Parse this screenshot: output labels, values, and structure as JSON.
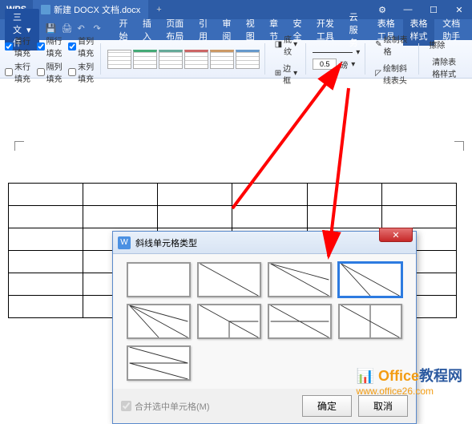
{
  "titlebar": {
    "app": "WPS",
    "doc_name": "新建 DOCX 文档.docx",
    "add_tab": "+"
  },
  "menu": {
    "file": "三 文件",
    "items": [
      "开始",
      "插入",
      "页面布局",
      "引用",
      "审阅",
      "视图",
      "章节",
      "安全",
      "开发工具",
      "云服务",
      "表格工具"
    ],
    "active": "表格样式",
    "extra": "文档助手"
  },
  "ribbon": {
    "checks": {
      "a": "首行填充",
      "b": "隔行填充",
      "c": "首列填充",
      "d": "末行填充",
      "e": "隔列填充",
      "f": "末列填充"
    },
    "shading": "底纹",
    "border": "边框",
    "line_width": "0.5",
    "line_unit": "磅",
    "draw_table": "绘制表格",
    "draw_diag": "绘制斜线表头",
    "eraser": "擦除",
    "clear_style": "清除表格样式"
  },
  "dialog": {
    "title": "斜线单元格类型",
    "merge": "合并选中单元格(M)",
    "ok": "确定",
    "cancel": "取消"
  },
  "watermark": {
    "brand1": "Office",
    "brand2": "教程网",
    "url": "www.office26.com"
  }
}
